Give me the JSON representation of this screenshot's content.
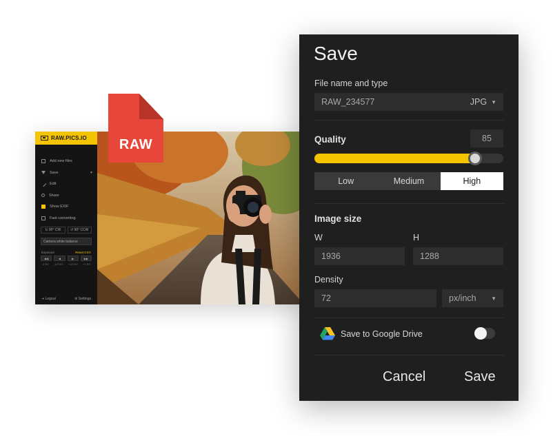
{
  "app": {
    "brand": "RAW.PICS.IO",
    "menu": [
      {
        "label": "Add new files",
        "icon": "plus-icon"
      },
      {
        "label": "Save",
        "icon": "download-icon",
        "caret": "▼"
      },
      {
        "label": "Edit",
        "icon": "pencil-icon"
      },
      {
        "label": "Share",
        "icon": "share-icon"
      },
      {
        "label": "Show EXIF",
        "icon": "checkbox-checked-icon"
      },
      {
        "label": "Fast converting",
        "icon": "checkbox-empty-icon"
      }
    ],
    "rotate_cw": "↻ 90° CW",
    "rotate_ccw": "↺ 90° CCW",
    "camera_wb": "Camera white balance",
    "exposure_label": "Exposure",
    "exposure_reset": "Reset 0 EV",
    "exposure_buttons": [
      "◀◀",
      "◀",
      "▶",
      "▶▶"
    ],
    "exposure_steps": [
      "-1 EV",
      "-1/3 EV",
      "+1/3 EV",
      "+1 EV"
    ],
    "logout": "Logout",
    "settings": "Settings"
  },
  "badge": {
    "text": "RAW",
    "color": "#e7473a"
  },
  "dialog": {
    "title": "Save",
    "file_label": "File name and type",
    "file_name": "RAW_234577",
    "file_type": "JPG",
    "quality_label": "Quality",
    "quality_value": "85",
    "quality_fraction": 0.85,
    "quality_options": [
      "Low",
      "Medium",
      "High"
    ],
    "quality_selected": "High",
    "image_size_label": "Image size",
    "w_label": "W",
    "h_label": "H",
    "width": "1936",
    "height": "1288",
    "density_label": "Density",
    "density": "72",
    "density_unit": "px/inch",
    "gdrive_label": "Save to Google Drive",
    "gdrive_enabled": false,
    "cancel": "Cancel",
    "save": "Save"
  },
  "colors": {
    "accent": "#f5c400",
    "dialog_bg": "#1f1f1f",
    "field_bg": "#2d2d2d"
  }
}
